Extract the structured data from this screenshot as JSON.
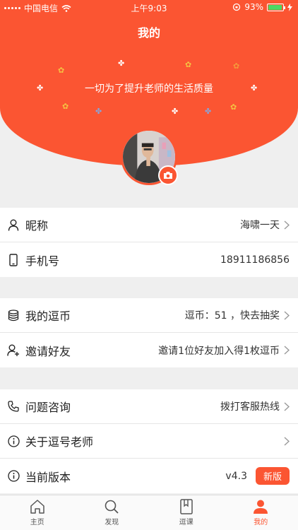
{
  "status_bar": {
    "carrier": "中国电信",
    "time": "上午9:03",
    "battery_percent": "93%",
    "battery_level": 0.93
  },
  "header": {
    "title": "我的",
    "slogan": "一切为了提升老师的生活质量"
  },
  "profile_rows": [
    {
      "label": "昵称",
      "value": "海啸一天",
      "icon": "user-icon"
    },
    {
      "label": "手机号",
      "value": "18911186856",
      "icon": "phone-icon"
    }
  ],
  "coin_rows": [
    {
      "label": "我的逗币",
      "value": "逗币：51 ，快去抽奖",
      "icon": "coins-icon"
    },
    {
      "label": "邀请好友",
      "value": "邀请1位好友加入得1枚逗币",
      "icon": "add-user-icon"
    }
  ],
  "info_rows": [
    {
      "label": "问题咨询",
      "value": "拨打客服热线",
      "icon": "telephone-icon"
    },
    {
      "label": "关于逗号老师",
      "value": "",
      "icon": "info-icon"
    },
    {
      "label": "当前版本",
      "value": "v4.3",
      "badge": "新版",
      "icon": "info-icon"
    }
  ],
  "tabbar": [
    {
      "label": "主页",
      "icon": "home-icon"
    },
    {
      "label": "发现",
      "icon": "search-icon"
    },
    {
      "label": "逗课",
      "icon": "book-icon"
    },
    {
      "label": "我的",
      "icon": "person-icon",
      "active": true
    }
  ],
  "colors": {
    "accent": "#fb5532",
    "background": "#efefef"
  }
}
